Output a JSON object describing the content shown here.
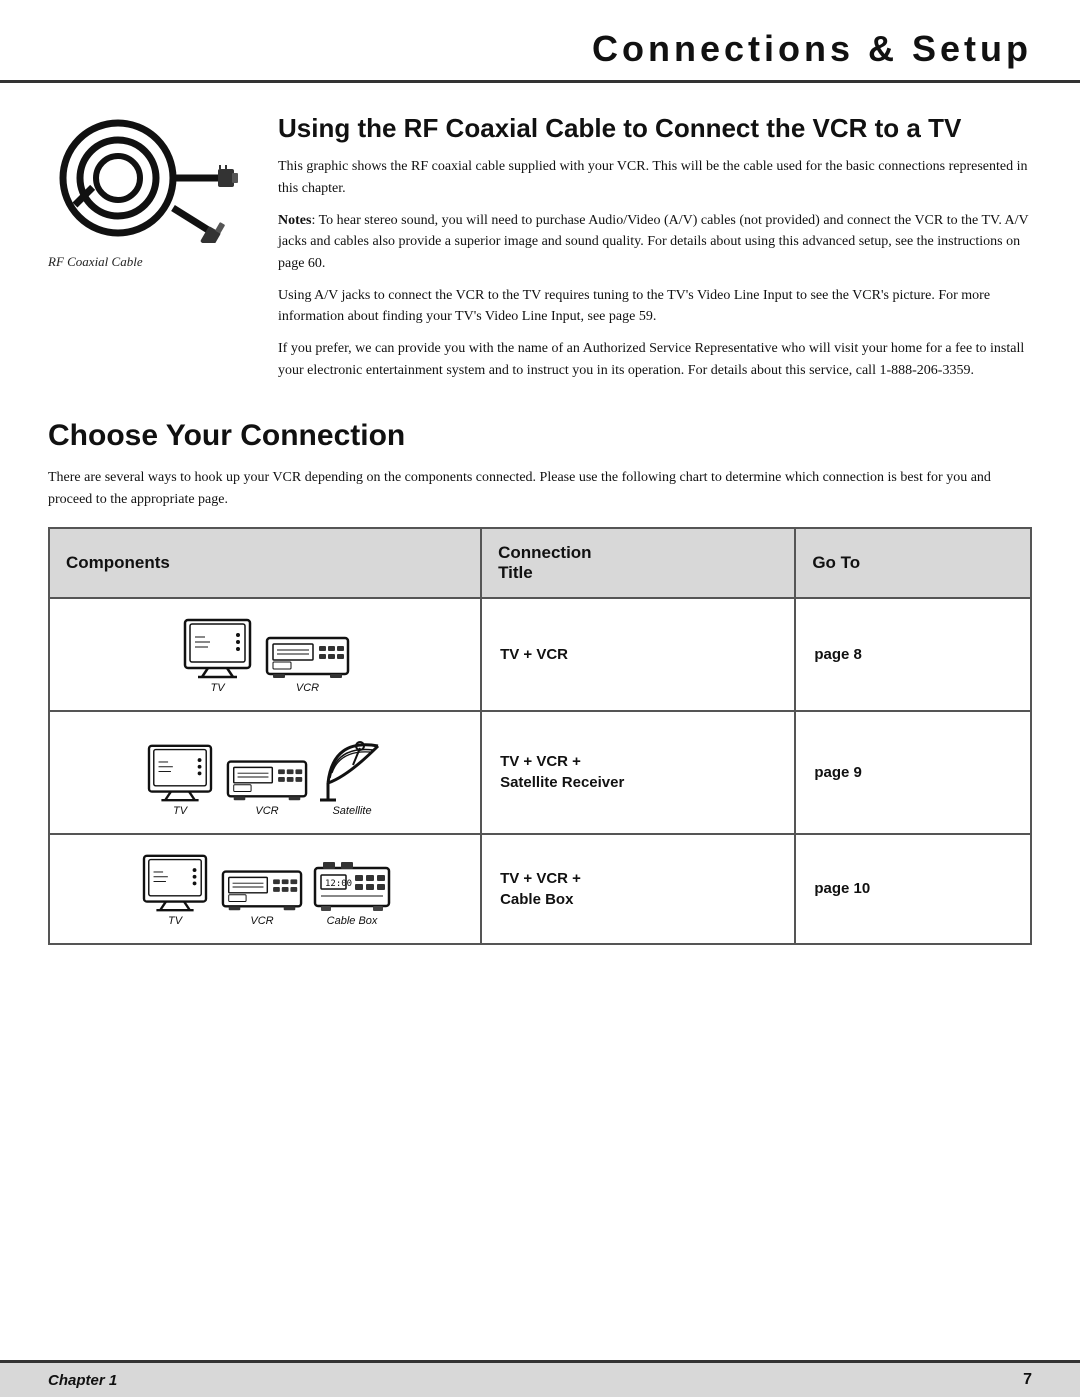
{
  "header": {
    "title": "Connections & Setup"
  },
  "rf_section": {
    "title": "Using the RF Coaxial Cable to Connect the VCR to a TV",
    "caption": "RF Coaxial Cable",
    "paragraphs": [
      "This graphic shows the RF coaxial cable supplied with your VCR. This will be the cable used for the basic connections represented in this chapter.",
      "Notes: To hear stereo sound, you will need to purchase Audio/Video (A/V) cables (not provided) and connect the VCR to the TV. A/V jacks and cables also provide a superior image and sound quality. For details about using this advanced setup, see the instructions on page 60.",
      "Using A/V jacks to connect the VCR to the TV requires tuning to the TV's Video Line Input to see the VCR's picture. For more information about finding your TV's Video Line Input, see page 59.",
      "If you prefer, we can provide you with the name of an Authorized Service Representative who will visit your home for a fee to install your electronic entertainment system and to instruct you in its operation. For details about this service, call 1-888-206-3359."
    ]
  },
  "choose_section": {
    "title": "Choose Your Connection",
    "intro": "There are several ways to hook up your VCR depending on the components connected. Please use the following chart to determine which connection is best for you and proceed to the appropriate page.",
    "table": {
      "headers": {
        "components": "Components",
        "connection_title": "Connection Title",
        "go_to": "Go To"
      },
      "rows": [
        {
          "components": [
            "TV",
            "VCR"
          ],
          "connection_title": "TV + VCR",
          "go_to": "page 8"
        },
        {
          "components": [
            "TV",
            "VCR",
            "Satellite"
          ],
          "connection_title": "TV + VCR + Satellite Receiver",
          "go_to": "page 9"
        },
        {
          "components": [
            "TV",
            "VCR",
            "Cable Box"
          ],
          "connection_title": "TV + VCR + Cable Box",
          "go_to": "page 10"
        }
      ]
    }
  },
  "footer": {
    "chapter": "Chapter 1",
    "page": "7"
  }
}
